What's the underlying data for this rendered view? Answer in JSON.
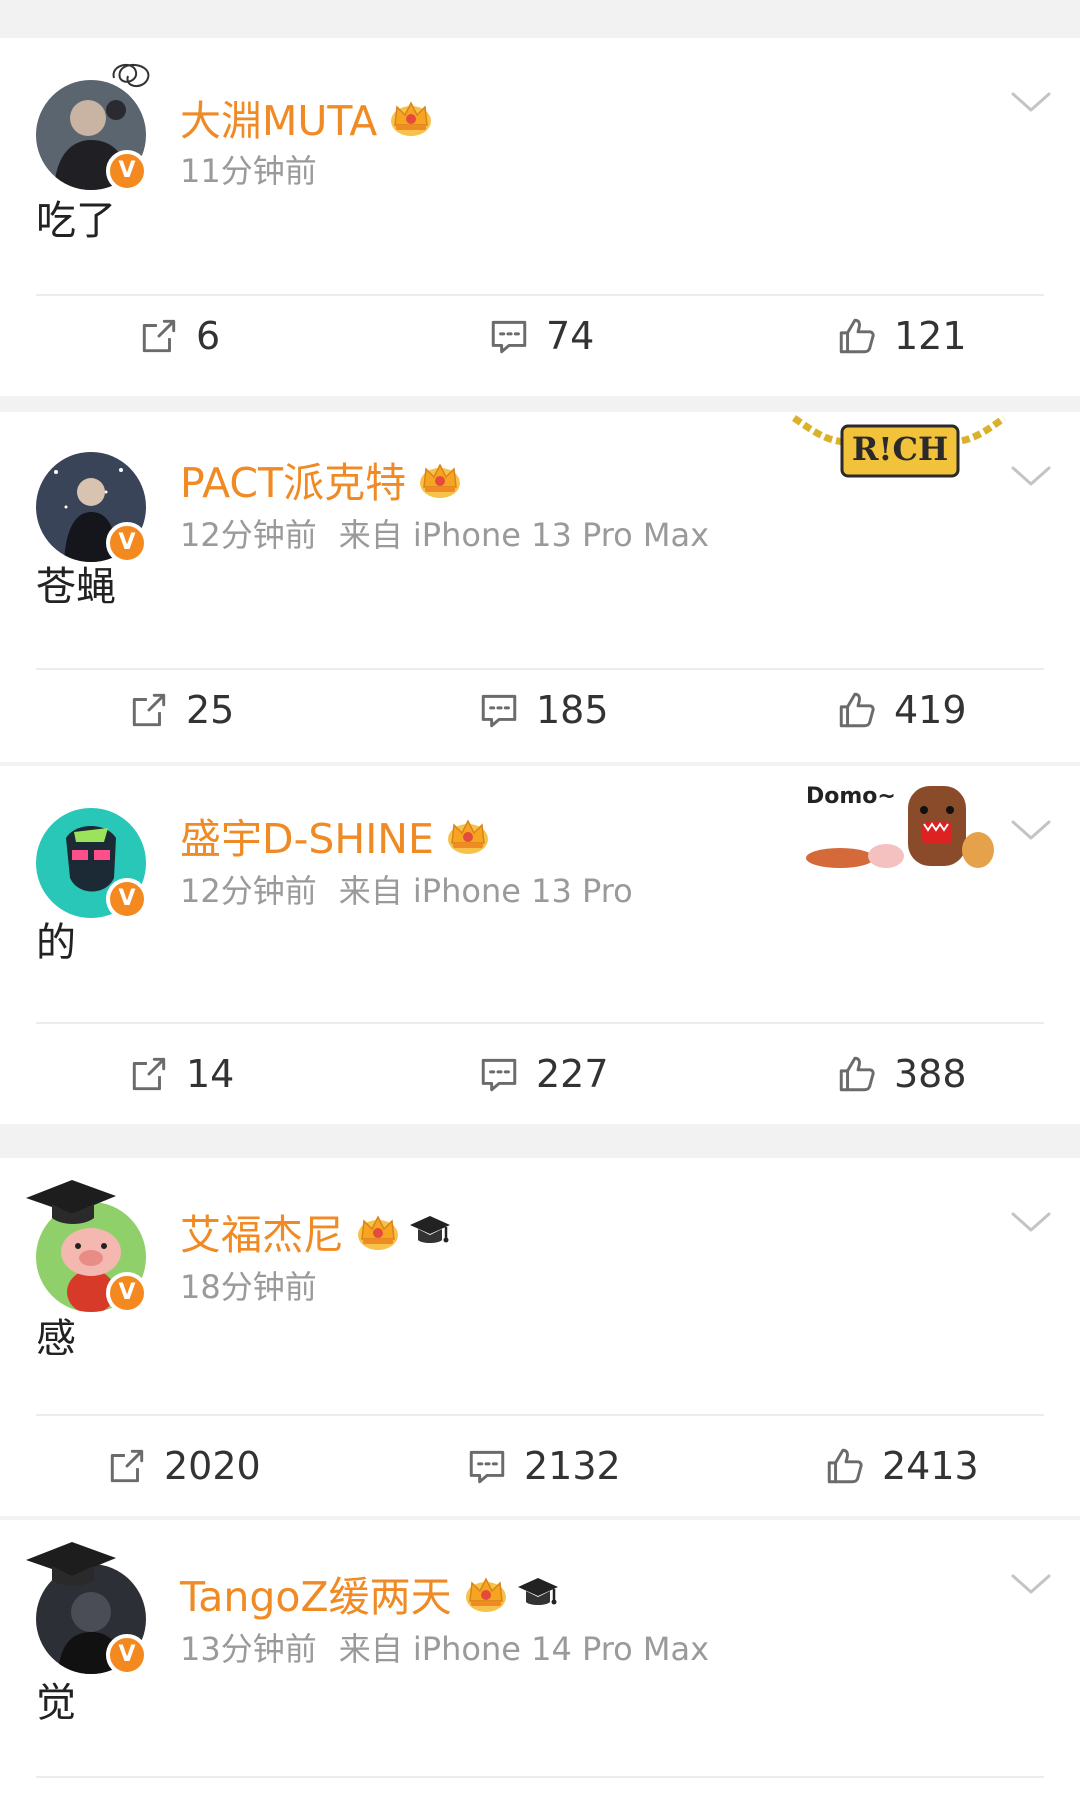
{
  "accent_color": "#f08a24",
  "posts": [
    {
      "name": "大淵MUTA",
      "time": "11分钟前",
      "source": "",
      "content": "吃了",
      "badges": [
        "crown-icon"
      ],
      "reposts": "6",
      "comments": "74",
      "likes": "121"
    },
    {
      "name": "PACT派克特",
      "time": "12分钟前",
      "source": "来自 iPhone 13 Pro Max",
      "content": "苍蝇",
      "badges": [
        "crown-icon"
      ],
      "decoration_text": "R!CH",
      "reposts": "25",
      "comments": "185",
      "likes": "419"
    },
    {
      "name": "盛宇D-SHINE",
      "time": "12分钟前",
      "source": "来自 iPhone 13 Pro",
      "content": "的",
      "badges": [
        "crown-icon"
      ],
      "decoration_text": "Domo~",
      "reposts": "14",
      "comments": "227",
      "likes": "388"
    },
    {
      "name": "艾福杰尼",
      "time": "18分钟前",
      "source": "",
      "content": "感",
      "badges": [
        "crown-icon",
        "graduation-cap-icon"
      ],
      "reposts": "2020",
      "comments": "2132",
      "likes": "2413"
    },
    {
      "name": "TangoZ缓两天",
      "time": "13分钟前",
      "source": "来自 iPhone 14 Pro Max",
      "content": "觉",
      "badges": [
        "crown-icon",
        "graduation-cap-icon"
      ]
    }
  ]
}
